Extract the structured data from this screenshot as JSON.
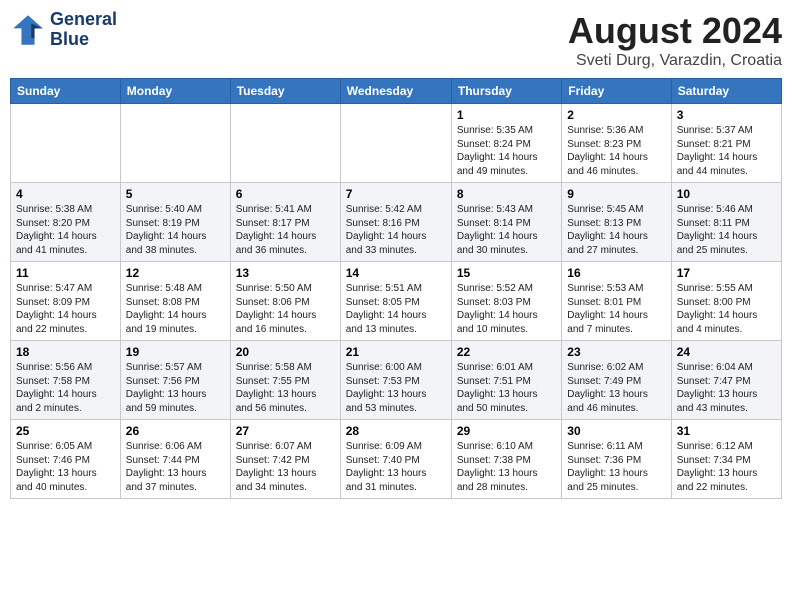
{
  "header": {
    "logo_line1": "General",
    "logo_line2": "Blue",
    "month": "August 2024",
    "location": "Sveti Durg, Varazdin, Croatia"
  },
  "weekdays": [
    "Sunday",
    "Monday",
    "Tuesday",
    "Wednesday",
    "Thursday",
    "Friday",
    "Saturday"
  ],
  "weeks": [
    [
      {
        "day": "",
        "info": ""
      },
      {
        "day": "",
        "info": ""
      },
      {
        "day": "",
        "info": ""
      },
      {
        "day": "",
        "info": ""
      },
      {
        "day": "1",
        "info": "Sunrise: 5:35 AM\nSunset: 8:24 PM\nDaylight: 14 hours\nand 49 minutes."
      },
      {
        "day": "2",
        "info": "Sunrise: 5:36 AM\nSunset: 8:23 PM\nDaylight: 14 hours\nand 46 minutes."
      },
      {
        "day": "3",
        "info": "Sunrise: 5:37 AM\nSunset: 8:21 PM\nDaylight: 14 hours\nand 44 minutes."
      }
    ],
    [
      {
        "day": "4",
        "info": "Sunrise: 5:38 AM\nSunset: 8:20 PM\nDaylight: 14 hours\nand 41 minutes."
      },
      {
        "day": "5",
        "info": "Sunrise: 5:40 AM\nSunset: 8:19 PM\nDaylight: 14 hours\nand 38 minutes."
      },
      {
        "day": "6",
        "info": "Sunrise: 5:41 AM\nSunset: 8:17 PM\nDaylight: 14 hours\nand 36 minutes."
      },
      {
        "day": "7",
        "info": "Sunrise: 5:42 AM\nSunset: 8:16 PM\nDaylight: 14 hours\nand 33 minutes."
      },
      {
        "day": "8",
        "info": "Sunrise: 5:43 AM\nSunset: 8:14 PM\nDaylight: 14 hours\nand 30 minutes."
      },
      {
        "day": "9",
        "info": "Sunrise: 5:45 AM\nSunset: 8:13 PM\nDaylight: 14 hours\nand 27 minutes."
      },
      {
        "day": "10",
        "info": "Sunrise: 5:46 AM\nSunset: 8:11 PM\nDaylight: 14 hours\nand 25 minutes."
      }
    ],
    [
      {
        "day": "11",
        "info": "Sunrise: 5:47 AM\nSunset: 8:09 PM\nDaylight: 14 hours\nand 22 minutes."
      },
      {
        "day": "12",
        "info": "Sunrise: 5:48 AM\nSunset: 8:08 PM\nDaylight: 14 hours\nand 19 minutes."
      },
      {
        "day": "13",
        "info": "Sunrise: 5:50 AM\nSunset: 8:06 PM\nDaylight: 14 hours\nand 16 minutes."
      },
      {
        "day": "14",
        "info": "Sunrise: 5:51 AM\nSunset: 8:05 PM\nDaylight: 14 hours\nand 13 minutes."
      },
      {
        "day": "15",
        "info": "Sunrise: 5:52 AM\nSunset: 8:03 PM\nDaylight: 14 hours\nand 10 minutes."
      },
      {
        "day": "16",
        "info": "Sunrise: 5:53 AM\nSunset: 8:01 PM\nDaylight: 14 hours\nand 7 minutes."
      },
      {
        "day": "17",
        "info": "Sunrise: 5:55 AM\nSunset: 8:00 PM\nDaylight: 14 hours\nand 4 minutes."
      }
    ],
    [
      {
        "day": "18",
        "info": "Sunrise: 5:56 AM\nSunset: 7:58 PM\nDaylight: 14 hours\nand 2 minutes."
      },
      {
        "day": "19",
        "info": "Sunrise: 5:57 AM\nSunset: 7:56 PM\nDaylight: 13 hours\nand 59 minutes."
      },
      {
        "day": "20",
        "info": "Sunrise: 5:58 AM\nSunset: 7:55 PM\nDaylight: 13 hours\nand 56 minutes."
      },
      {
        "day": "21",
        "info": "Sunrise: 6:00 AM\nSunset: 7:53 PM\nDaylight: 13 hours\nand 53 minutes."
      },
      {
        "day": "22",
        "info": "Sunrise: 6:01 AM\nSunset: 7:51 PM\nDaylight: 13 hours\nand 50 minutes."
      },
      {
        "day": "23",
        "info": "Sunrise: 6:02 AM\nSunset: 7:49 PM\nDaylight: 13 hours\nand 46 minutes."
      },
      {
        "day": "24",
        "info": "Sunrise: 6:04 AM\nSunset: 7:47 PM\nDaylight: 13 hours\nand 43 minutes."
      }
    ],
    [
      {
        "day": "25",
        "info": "Sunrise: 6:05 AM\nSunset: 7:46 PM\nDaylight: 13 hours\nand 40 minutes."
      },
      {
        "day": "26",
        "info": "Sunrise: 6:06 AM\nSunset: 7:44 PM\nDaylight: 13 hours\nand 37 minutes."
      },
      {
        "day": "27",
        "info": "Sunrise: 6:07 AM\nSunset: 7:42 PM\nDaylight: 13 hours\nand 34 minutes."
      },
      {
        "day": "28",
        "info": "Sunrise: 6:09 AM\nSunset: 7:40 PM\nDaylight: 13 hours\nand 31 minutes."
      },
      {
        "day": "29",
        "info": "Sunrise: 6:10 AM\nSunset: 7:38 PM\nDaylight: 13 hours\nand 28 minutes."
      },
      {
        "day": "30",
        "info": "Sunrise: 6:11 AM\nSunset: 7:36 PM\nDaylight: 13 hours\nand 25 minutes."
      },
      {
        "day": "31",
        "info": "Sunrise: 6:12 AM\nSunset: 7:34 PM\nDaylight: 13 hours\nand 22 minutes."
      }
    ]
  ]
}
